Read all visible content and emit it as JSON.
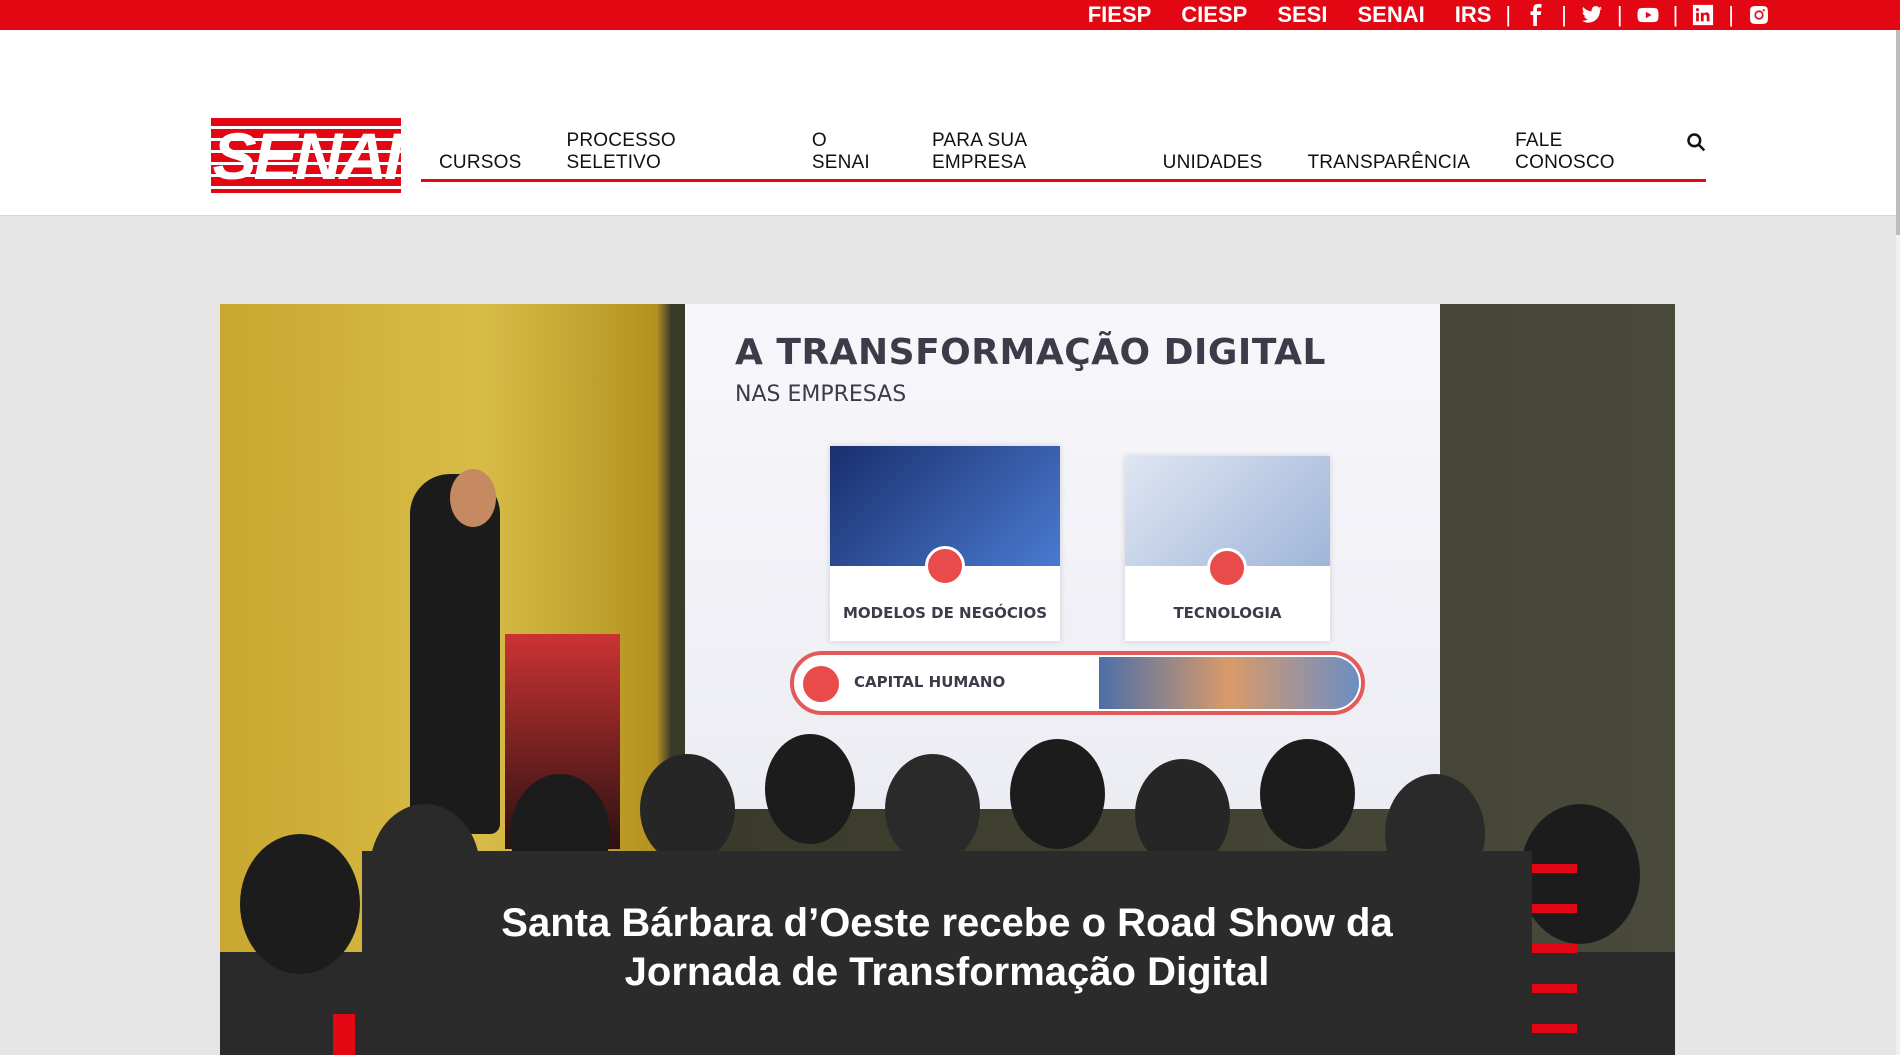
{
  "topbar": {
    "links": [
      "FIESP",
      "CIESP",
      "SESI",
      "SENAI",
      "IRS"
    ],
    "social": [
      "facebook-icon",
      "twitter-icon",
      "youtube-icon",
      "linkedin-icon",
      "instagram-icon"
    ],
    "separator": "|"
  },
  "brand": {
    "logo_text": "SENAI",
    "color": "#e30613"
  },
  "nav": {
    "items": [
      "CURSOS",
      "PROCESSO SELETIVO",
      "O SENAI",
      "PARA SUA EMPRESA",
      "UNIDADES",
      "TRANSPARÊNCIA",
      "FALE CONOSCO"
    ],
    "search_icon": "search-icon"
  },
  "hero": {
    "screen_title": "A TRANSFORMAÇÃO DIGITAL",
    "screen_subtitle": "NAS EMPRESAS",
    "cards": [
      "MODELOS DE NEGÓCIOS",
      "TECNOLOGIA"
    ],
    "pill_label": "CAPITAL HUMANO",
    "caption": "Santa Bárbara d’Oeste recebe o Road Show da Jornada de Transformação Digital"
  }
}
